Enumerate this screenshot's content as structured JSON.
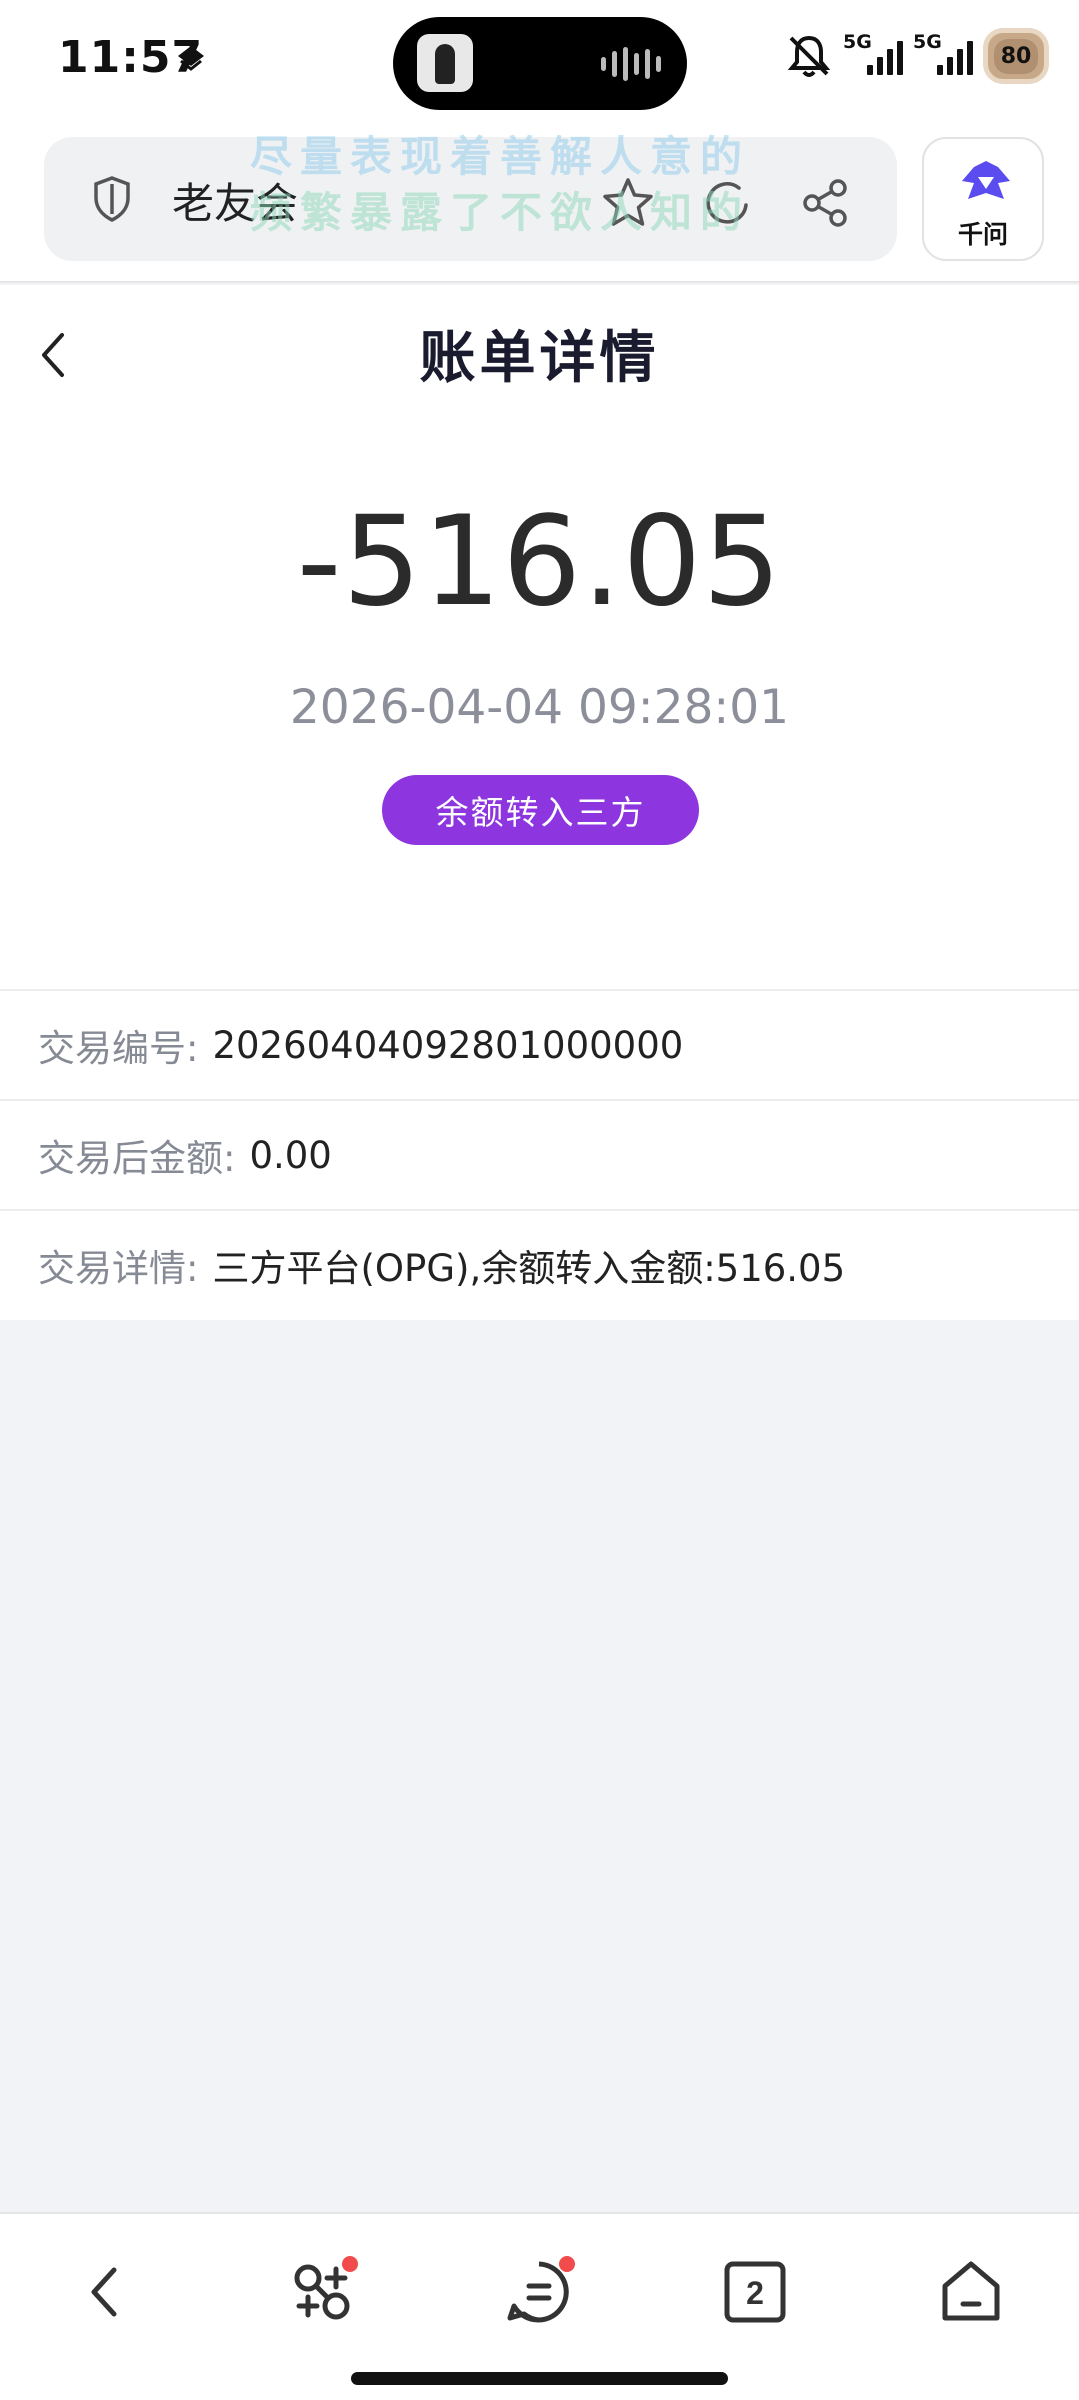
{
  "status_bar": {
    "time": "11:57",
    "signal_1_label": "5G",
    "signal_2_label": "5G",
    "battery_level": "80"
  },
  "browser": {
    "site_title": "老友会",
    "watermark_line1": "尽量表现着善解人意的",
    "watermark_line2": "频繁暴露了不欲人知的",
    "assistant_label": "千问",
    "tab_count": "2"
  },
  "page": {
    "title": "账单详情",
    "amount": "-516.05",
    "datetime": "2026-04-04 09:28:01",
    "type_badge": "余额转入三方"
  },
  "details": [
    {
      "label": "交易编号:",
      "value": "20260404092801000000"
    },
    {
      "label": "交易后金额:",
      "value": "0.00"
    },
    {
      "label": "交易详情:",
      "value": "三方平台(OPG),余额转入金额:516.05"
    }
  ],
  "colors": {
    "accent": "#8d36e0",
    "amount_text": "#2b2b2b",
    "muted_text": "#8c8f99",
    "page_background": "#f2f3f7",
    "notification_dot": "#f24b4b"
  },
  "icons": {
    "nav_arrow": "navigation-arrow-icon",
    "mute": "bell-muted-icon",
    "shield": "shield-icon",
    "star": "star-icon",
    "refresh": "refresh-icon",
    "share": "share-icon",
    "back": "chevron-left-icon",
    "nav_back": "back-icon",
    "nav_discover": "discover-icon",
    "nav_menu": "menu-icon",
    "nav_tabs": "tabs-icon",
    "nav_home": "home-icon"
  }
}
